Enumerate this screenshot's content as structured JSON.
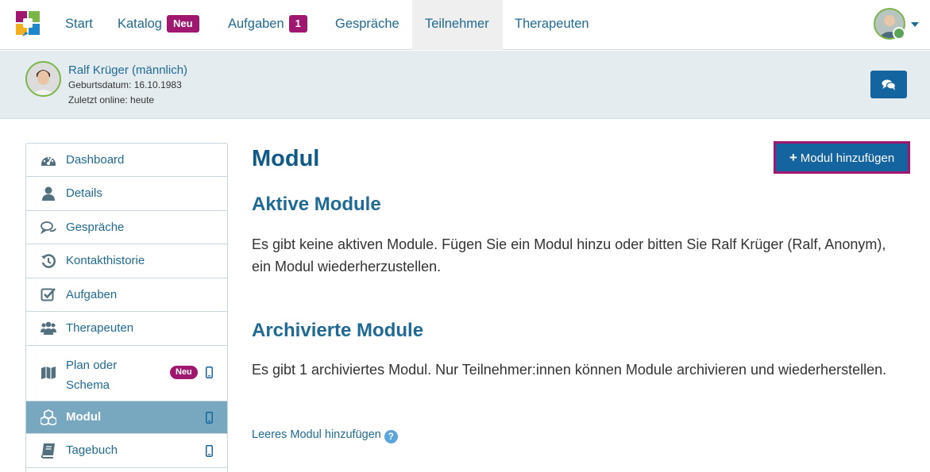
{
  "nav": {
    "items": [
      {
        "label": "Start"
      },
      {
        "label": "Katalog",
        "badge": "Neu"
      },
      {
        "label": "Aufgaben",
        "badge": "1"
      },
      {
        "label": "Gespräche"
      },
      {
        "label": "Teilnehmer",
        "active": true
      },
      {
        "label": "Therapeuten"
      }
    ]
  },
  "participant": {
    "name": "Ralf Krüger (männlich)",
    "birthdate": "Geburtsdatum: 16.10.1983",
    "last_online": "Zuletzt online: heute"
  },
  "sidebar": {
    "items": [
      {
        "label": "Dashboard",
        "icon": "dashboard-icon"
      },
      {
        "label": "Details",
        "icon": "user-icon"
      },
      {
        "label": "Gespräche",
        "icon": "chat-icon"
      },
      {
        "label": "Kontakthistorie",
        "icon": "history-icon"
      },
      {
        "label": "Aufgaben",
        "icon": "checkbox-icon"
      },
      {
        "label": "Therapeuten",
        "icon": "users-icon"
      },
      {
        "label": "Plan oder Schema",
        "line1": "Plan oder",
        "line2": "Schema",
        "badge": "Neu",
        "icon": "map-icon",
        "mobile": true
      },
      {
        "label": "Modul",
        "icon": "cubes-icon",
        "mobile": true,
        "active": true
      },
      {
        "label": "Tagebuch",
        "icon": "book-icon",
        "mobile": true
      }
    ]
  },
  "main": {
    "title": "Modul",
    "add_button": "Modul hinzufügen",
    "active_heading": "Aktive Module",
    "active_text": "Es gibt keine aktiven Module. Fügen Sie ein Modul hinzu oder bitten Sie Ralf Krüger (Ralf, Anonym), ein Modul wiederherzustellen.",
    "archived_heading": "Archivierte Module",
    "archived_text": "Es gibt 1 archiviertes Modul. Nur Teilnehmer:innen können Module archivieren und wiederherstellen.",
    "empty_module_link": "Leeres Modul hinzufügen",
    "help_glyph": "?"
  },
  "colors": {
    "primary": "#1464a0",
    "accent": "#a0176f",
    "link": "#1f6a94",
    "sidebar_active": "#78a8c0"
  }
}
